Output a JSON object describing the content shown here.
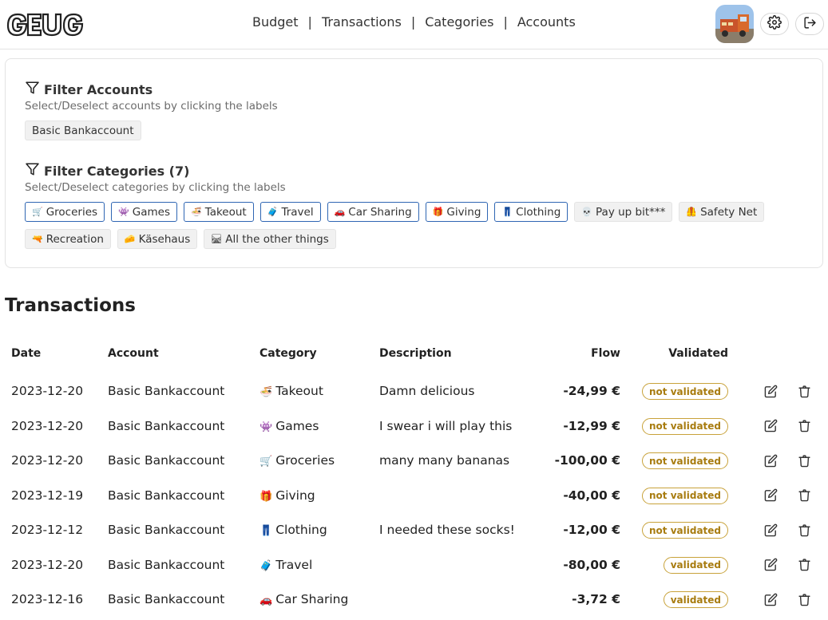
{
  "header": {
    "nav": [
      "Budget",
      "Transactions",
      "Categories",
      "Accounts"
    ],
    "separator": "|",
    "logo_icon": "logo-wordmark",
    "avatar_icon": "avatar-truck-image",
    "settings_icon": "gear-icon",
    "logout_icon": "logout-icon"
  },
  "filters": {
    "accounts": {
      "title": "Filter Accounts",
      "hint": "Select/Deselect accounts by clicking the labels",
      "items": [
        {
          "label": "Basic Bankaccount",
          "selected": false
        }
      ]
    },
    "categories": {
      "title": "Filter Categories (7)",
      "hint": "Select/Deselect categories by clicking the labels",
      "items": [
        {
          "emoji": "🛒",
          "label": "Groceries",
          "selected": true
        },
        {
          "emoji": "👾",
          "label": "Games",
          "selected": true
        },
        {
          "emoji": "🍜",
          "label": "Takeout",
          "selected": true
        },
        {
          "emoji": "🧳",
          "label": "Travel",
          "selected": true
        },
        {
          "emoji": "🚗",
          "label": "Car Sharing",
          "selected": true
        },
        {
          "emoji": "🎁",
          "label": "Giving",
          "selected": true
        },
        {
          "emoji": "👖",
          "label": "Clothing",
          "selected": true
        },
        {
          "emoji": "💀",
          "label": "Pay up bit***",
          "selected": false
        },
        {
          "emoji": "🦺",
          "label": "Safety Net",
          "selected": false
        },
        {
          "emoji": "🔫",
          "label": "Recreation",
          "selected": false
        },
        {
          "emoji": "🧀",
          "label": "Käsehaus",
          "selected": false
        },
        {
          "emoji": "🛤",
          "label": "All the other things",
          "selected": false
        }
      ]
    }
  },
  "transactions": {
    "heading": "Transactions",
    "columns": [
      "Date",
      "Account",
      "Category",
      "Description",
      "Flow",
      "Validated"
    ],
    "rows": [
      {
        "date": "2023-12-20",
        "account": "Basic Bankaccount",
        "category_emoji": "🍜",
        "category": "Takeout",
        "description": "Damn delicious",
        "flow": "-24,99 €",
        "status": "not validated"
      },
      {
        "date": "2023-12-20",
        "account": "Basic Bankaccount",
        "category_emoji": "👾",
        "category": "Games",
        "description": "I swear i will play this",
        "flow": "-12,99 €",
        "status": "not validated"
      },
      {
        "date": "2023-12-20",
        "account": "Basic Bankaccount",
        "category_emoji": "🛒",
        "category": "Groceries",
        "description": "many many bananas",
        "flow": "-100,00 €",
        "status": "not validated"
      },
      {
        "date": "2023-12-19",
        "account": "Basic Bankaccount",
        "category_emoji": "🎁",
        "category": "Giving",
        "description": "",
        "flow": "-40,00 €",
        "status": "not validated"
      },
      {
        "date": "2023-12-12",
        "account": "Basic Bankaccount",
        "category_emoji": "👖",
        "category": "Clothing",
        "description": "I needed these socks!",
        "flow": "-12,00 €",
        "status": "not validated"
      },
      {
        "date": "2023-12-20",
        "account": "Basic Bankaccount",
        "category_emoji": "🧳",
        "category": "Travel",
        "description": "",
        "flow": "-80,00 €",
        "status": "validated"
      },
      {
        "date": "2023-12-16",
        "account": "Basic Bankaccount",
        "category_emoji": "🚗",
        "category": "Car Sharing",
        "description": "",
        "flow": "-3,72 €",
        "status": "validated"
      }
    ],
    "edit_icon": "edit-icon",
    "delete_icon": "trash-icon"
  },
  "colors": {
    "selected_border": "#2f66b3",
    "badge": "#c8a23a",
    "badge_text": "#a87c10"
  }
}
